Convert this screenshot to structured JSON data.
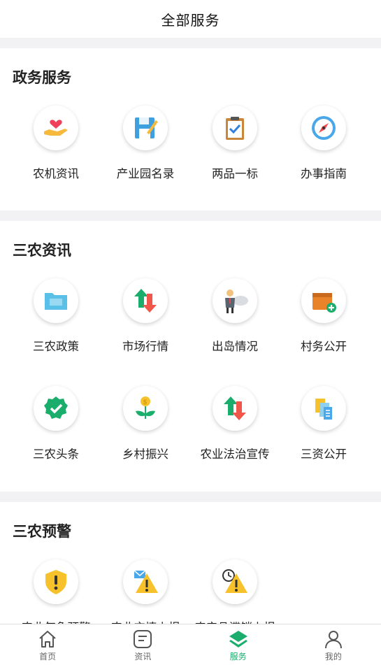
{
  "header": {
    "title": "全部服务"
  },
  "sections": [
    {
      "heading": "政务服务",
      "items": [
        {
          "label": "农机资讯",
          "icon": "hand-heart-icon"
        },
        {
          "label": "产业园名录",
          "icon": "floppy-disk-icon"
        },
        {
          "label": "两品一标",
          "icon": "clipboard-check-icon"
        },
        {
          "label": "办事指南",
          "icon": "compass-icon"
        }
      ]
    },
    {
      "heading": "三农资讯",
      "items": [
        {
          "label": "三农政策",
          "icon": "folder-icon"
        },
        {
          "label": "市场行情",
          "icon": "up-down-arrows-icon"
        },
        {
          "label": "出岛情况",
          "icon": "person-cloud-icon"
        },
        {
          "label": "村务公开",
          "icon": "box-add-icon"
        },
        {
          "label": "三农头条",
          "icon": "check-badge-icon"
        },
        {
          "label": "乡村振兴",
          "icon": "sprout-coin-icon"
        },
        {
          "label": "农业法治宣传",
          "icon": "up-down-arrows-icon"
        },
        {
          "label": "三资公开",
          "icon": "documents-icon"
        }
      ]
    },
    {
      "heading": "三农预警",
      "items": [
        {
          "label": "农业气象预警",
          "icon": "shield-warning-icon"
        },
        {
          "label": "农业灾情上报",
          "icon": "mail-warning-icon"
        },
        {
          "label": "农产品滞销上报",
          "icon": "clock-warning-icon"
        }
      ]
    }
  ],
  "tabbar": [
    {
      "label": "首页",
      "icon": "home-icon",
      "active": false
    },
    {
      "label": "资讯",
      "icon": "message-icon",
      "active": false
    },
    {
      "label": "服务",
      "icon": "layers-icon",
      "active": true
    },
    {
      "label": "我的",
      "icon": "user-icon",
      "active": false
    }
  ],
  "colors": {
    "accent": "#1aad6b",
    "background": "#f2f2f5"
  }
}
